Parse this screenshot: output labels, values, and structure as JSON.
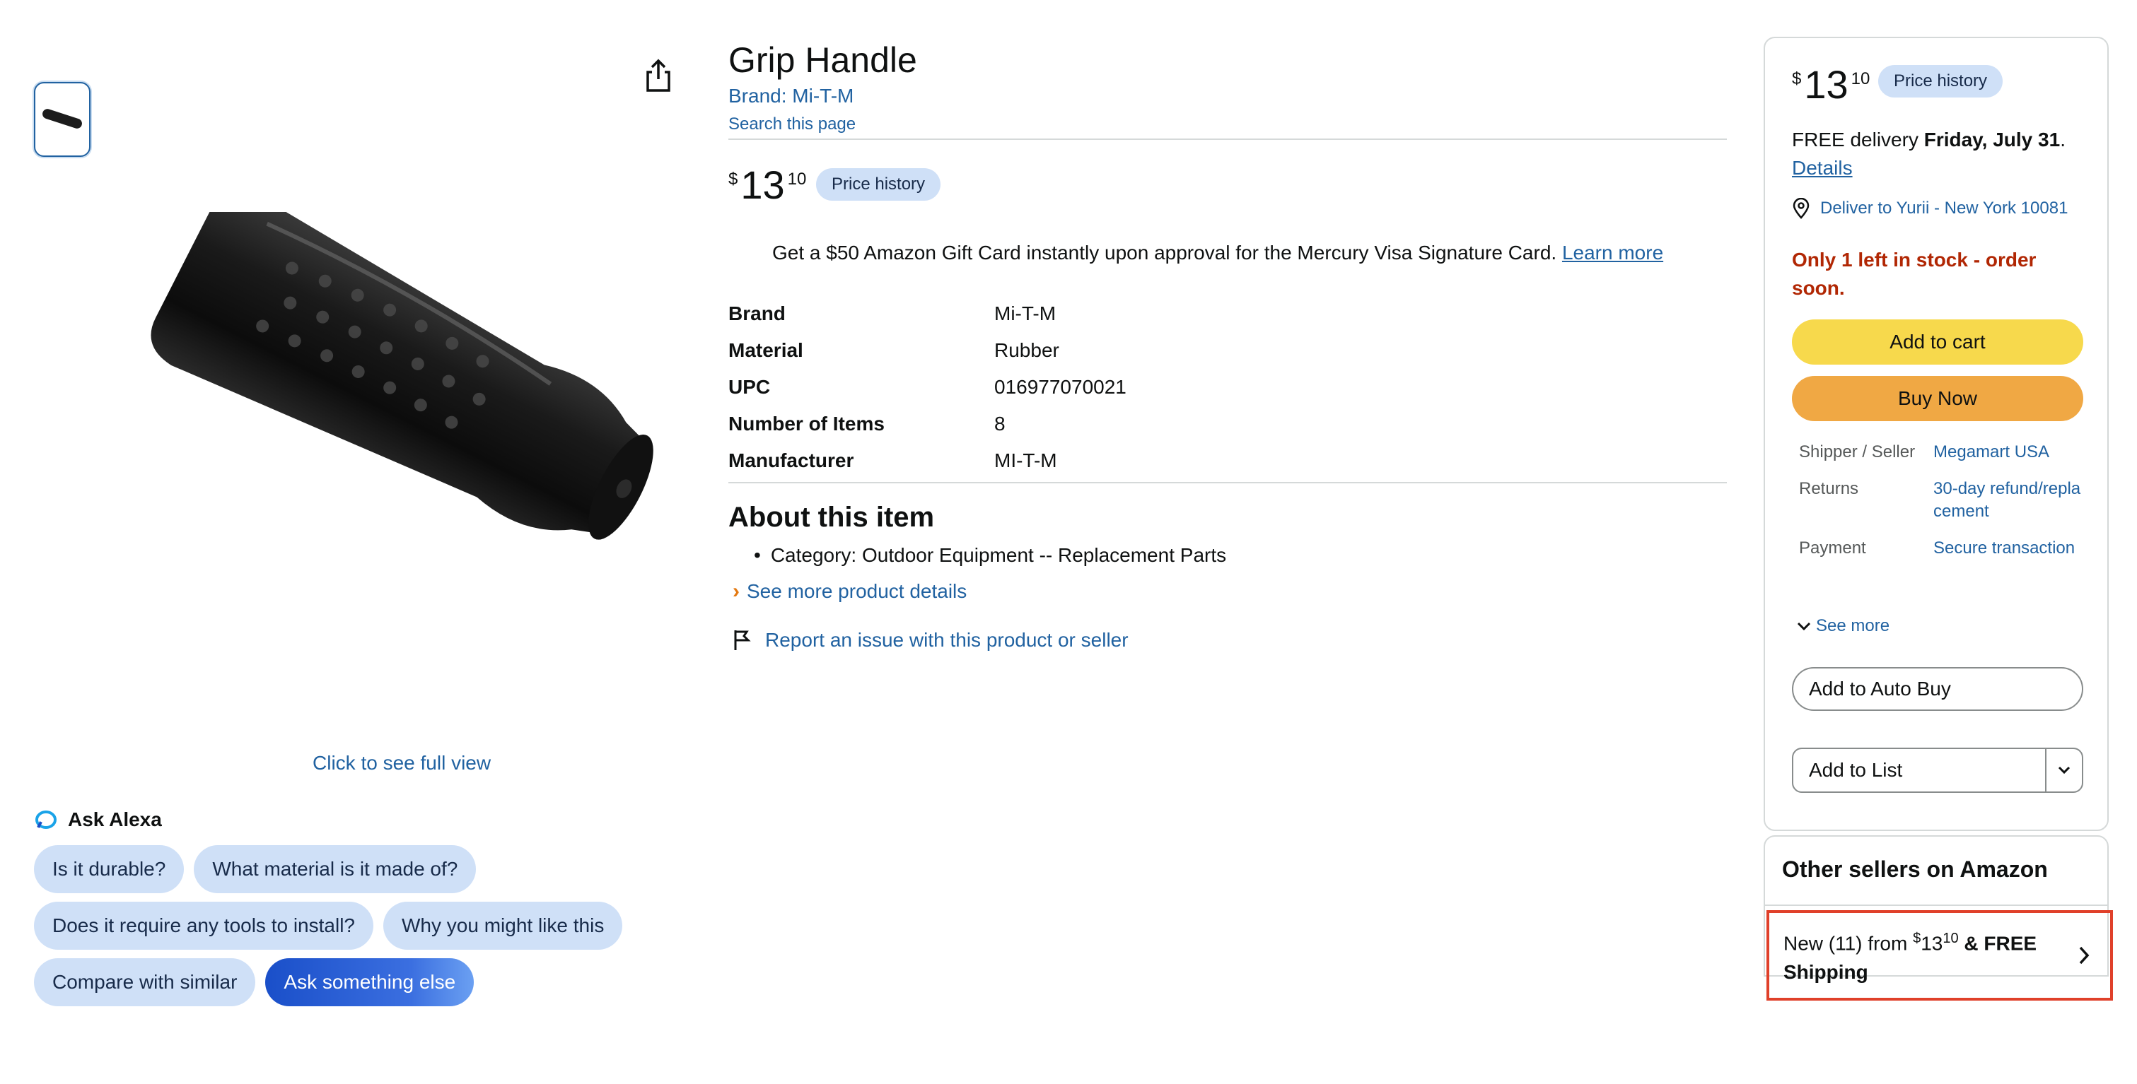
{
  "product": {
    "title": "Grip Handle",
    "brand_link": "Brand: Mi-T-M",
    "search_page": "Search this page",
    "price": {
      "symbol": "$",
      "whole": "13",
      "fraction": "10"
    },
    "price_history_label": "Price history",
    "promo_text": "Get a $50 Amazon Gift Card instantly upon approval for the Mercury Visa Signature Card.",
    "promo_link": "Learn more"
  },
  "specs": [
    {
      "key": "Brand",
      "value": "Mi-T-M"
    },
    {
      "key": "Material",
      "value": "Rubber"
    },
    {
      "key": "UPC",
      "value": "016977070021"
    },
    {
      "key": "Number of Items",
      "value": "8"
    },
    {
      "key": "Manufacturer",
      "value": "MI-T-M"
    }
  ],
  "about": {
    "title": "About this item",
    "bullets": [
      "Category: Outdoor Equipment -- Replacement Parts"
    ],
    "see_more": "See more product details",
    "report": "Report an issue with this product or seller"
  },
  "gallery": {
    "full_view": "Click to see full view"
  },
  "alexa": {
    "title": "Ask Alexa",
    "chips": [
      "Is it durable?",
      "What material is it made of?",
      "Does it require any tools to install?",
      "Why you might like this",
      "Compare with similar",
      "Ask something else"
    ]
  },
  "buybox": {
    "price": {
      "symbol": "$",
      "whole": "13",
      "fraction": "10"
    },
    "price_history_label": "Price history",
    "delivery_prefix": "FREE delivery",
    "delivery_date": "Friday, July 31",
    "delivery_suffix": ".",
    "details_link": "Details",
    "deliver_to": "Deliver to Yurii - New York 10081",
    "stock": "Only 1 left in stock - order soon.",
    "add_to_cart": "Add to cart",
    "buy_now": "Buy Now",
    "info": [
      {
        "key": "Shipper / Seller",
        "value": "Megamart USA"
      },
      {
        "key": "Returns",
        "value": "30-day refund/replacement"
      },
      {
        "key": "Payment",
        "value": "Secure transaction"
      }
    ],
    "see_more": "See more",
    "auto_buy": "Add to Auto Buy",
    "add_to_list": "Add to List"
  },
  "other_sellers": {
    "title": "Other sellers on Amazon",
    "offer_prefix": "New (11) from",
    "offer_price_symbol": "$",
    "offer_price_whole": "13",
    "offer_price_fraction": "10",
    "offer_shipping": "& FREE Shipping"
  },
  "colors": {
    "link": "#2162a1",
    "add_to_cart": "#f7d94c",
    "buy_now": "#f0a844",
    "stock_warning": "#b12704",
    "highlight_border": "#e0402a"
  }
}
